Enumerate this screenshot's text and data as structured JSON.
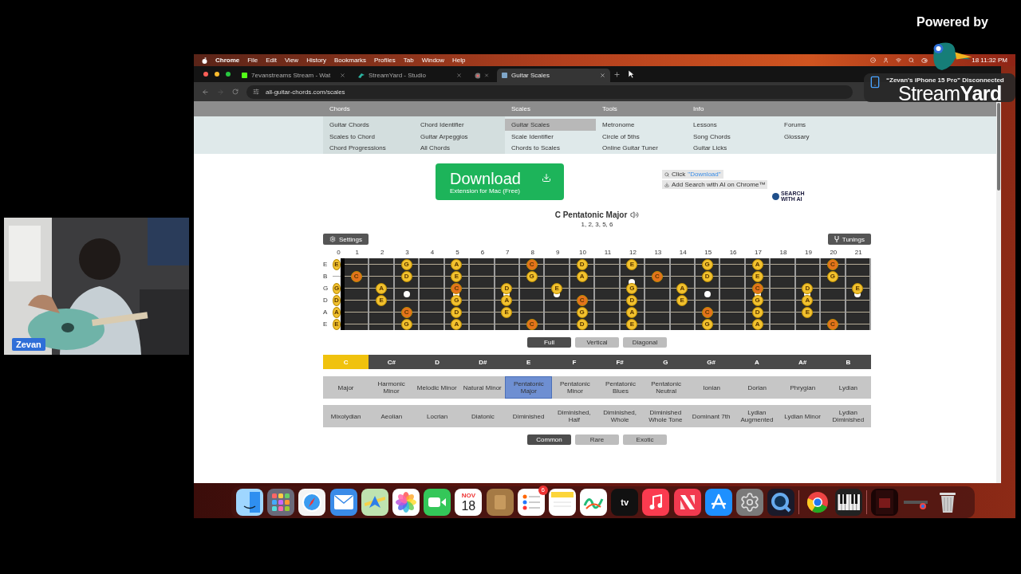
{
  "stream": {
    "powered_by": "Powered by",
    "logo": "Stream**Yard**",
    "participant": "Zevan"
  },
  "menu_bar": {
    "app": "Chrome",
    "items": [
      "File",
      "Edit",
      "View",
      "History",
      "Bookmarks",
      "Profiles",
      "Tab",
      "Window",
      "Help"
    ],
    "clock": "18 11:32 PM"
  },
  "notification": {
    "title": "“Zevan's iPhone 15 Pro” Disconnected"
  },
  "browser": {
    "tabs": [
      {
        "kind": "k",
        "title": "7evanstreams Stream - Wat",
        "selected": false
      },
      {
        "kind": "bird",
        "title": "StreamYard - Studio",
        "selected": false
      },
      {
        "kind": "record",
        "selected": false
      },
      {
        "kind": "page",
        "title": "Guitar Scales",
        "selected": true
      }
    ],
    "url": "all-guitar-chords.com/scales"
  },
  "nav": {
    "groups": [
      {
        "heading": "Chords",
        "columns": [
          {
            "items": [
              {
                "label": "Guitar Chords",
                "selected": false
              },
              {
                "label": "Scales to Chord",
                "selected": false
              },
              {
                "label": "Chord Progressions",
                "selected": false
              }
            ]
          },
          {
            "items": [
              {
                "label": "Chord Identifier",
                "selected": false
              },
              {
                "label": "Guitar Arpeggios",
                "selected": false
              },
              {
                "label": "All Chords",
                "selected": false
              }
            ]
          }
        ]
      },
      {
        "heading": "Scales",
        "columns": [
          {
            "items": [
              {
                "label": "Guitar Scales",
                "selected": true
              },
              {
                "label": "Scale Identifier",
                "selected": false
              },
              {
                "label": "Chords to Scales",
                "selected": false
              }
            ]
          }
        ]
      },
      {
        "heading": "Tools",
        "columns": [
          {
            "items": [
              {
                "label": "Metronome",
                "selected": false
              },
              {
                "label": "Circle of 5ths",
                "selected": false
              },
              {
                "label": "Online Guitar Tuner",
                "selected": false
              }
            ]
          }
        ]
      },
      {
        "heading": "Info",
        "columns": [
          {
            "items": [
              {
                "label": "Lessons",
                "selected": false
              },
              {
                "label": "Song Chords",
                "selected": false
              },
              {
                "label": "Guitar Licks",
                "selected": false
              }
            ]
          },
          {
            "items": [
              {
                "label": "Forums",
                "selected": false
              },
              {
                "label": "Glossary",
                "selected": false
              }
            ]
          }
        ]
      }
    ]
  },
  "ad": {
    "button": "Download",
    "button_sub": "Extension for Mac (Free)",
    "click": "Click",
    "click_link": "\"Download\"",
    "add": "Add Search with AI on Chrome™",
    "badge": "SEARCH WITH AI"
  },
  "scale": {
    "title": "C Pentatonic Major",
    "formula": "1, 2, 3, 5, 6"
  },
  "settings_button": "Settings",
  "tunings_button": "Tunings",
  "fretboard": {
    "frets": [
      "0",
      "1",
      "2",
      "3",
      "4",
      "5",
      "6",
      "7",
      "8",
      "9",
      "10",
      "11",
      "12",
      "13",
      "14",
      "15",
      "16",
      "17",
      "18",
      "19",
      "20",
      "21"
    ],
    "strings": [
      {
        "label": "E",
        "cells": [
          {
            "note": "E",
            "color": "#f2c12e"
          },
          null,
          null,
          {
            "note": "G",
            "color": "#f2c12e"
          },
          null,
          {
            "note": "A",
            "color": "#f2c12e"
          },
          null,
          null,
          {
            "note": "C",
            "color": "#e4731c"
          },
          null,
          {
            "note": "D",
            "color": "#f2c12e"
          },
          null,
          {
            "note": "E",
            "color": "#f2c12e"
          },
          null,
          null,
          {
            "note": "G",
            "color": "#f2c12e"
          },
          null,
          {
            "note": "A",
            "color": "#f2c12e"
          },
          null,
          null,
          {
            "note": "C",
            "color": "#e4731c"
          },
          null
        ]
      },
      {
        "label": "B",
        "cells": [
          null,
          {
            "note": "C",
            "color": "#e4731c"
          },
          null,
          {
            "note": "D",
            "color": "#f2c12e"
          },
          null,
          {
            "note": "E",
            "color": "#f2c12e"
          },
          null,
          null,
          {
            "note": "G",
            "color": "#f2c12e"
          },
          null,
          {
            "note": "A",
            "color": "#f2c12e"
          },
          null,
          null,
          {
            "note": "C",
            "color": "#e4731c"
          },
          null,
          {
            "note": "D",
            "color": "#f2c12e"
          },
          null,
          {
            "note": "E",
            "color": "#f2c12e"
          },
          null,
          null,
          {
            "note": "G",
            "color": "#f2c12e"
          },
          null
        ]
      },
      {
        "label": "G",
        "cells": [
          {
            "note": "G",
            "color": "#f2c12e"
          },
          null,
          {
            "note": "A",
            "color": "#f2c12e"
          },
          null,
          null,
          {
            "note": "C",
            "color": "#e4731c"
          },
          null,
          {
            "note": "D",
            "color": "#f2c12e"
          },
          null,
          {
            "note": "E",
            "color": "#f2c12e"
          },
          null,
          null,
          {
            "note": "G",
            "color": "#f2c12e"
          },
          null,
          {
            "note": "A",
            "color": "#f2c12e"
          },
          null,
          null,
          {
            "note": "C",
            "color": "#e4731c"
          },
          null,
          {
            "note": "D",
            "color": "#f2c12e"
          },
          null,
          {
            "note": "E",
            "color": "#f2c12e"
          }
        ]
      },
      {
        "label": "D",
        "cells": [
          {
            "note": "D",
            "color": "#f2c12e"
          },
          null,
          {
            "note": "E",
            "color": "#f2c12e"
          },
          null,
          null,
          {
            "note": "G",
            "color": "#f2c12e"
          },
          null,
          {
            "note": "A",
            "color": "#f2c12e"
          },
          null,
          null,
          {
            "note": "C",
            "color": "#e4731c"
          },
          null,
          {
            "note": "D",
            "color": "#f2c12e"
          },
          null,
          {
            "note": "E",
            "color": "#f2c12e"
          },
          null,
          null,
          {
            "note": "G",
            "color": "#f2c12e"
          },
          null,
          {
            "note": "A",
            "color": "#f2c12e"
          },
          null,
          null
        ]
      },
      {
        "label": "A",
        "cells": [
          {
            "note": "A",
            "color": "#f2c12e"
          },
          null,
          null,
          {
            "note": "C",
            "color": "#e4731c"
          },
          null,
          {
            "note": "D",
            "color": "#f2c12e"
          },
          null,
          {
            "note": "E",
            "color": "#f2c12e"
          },
          null,
          null,
          {
            "note": "G",
            "color": "#f2c12e"
          },
          null,
          {
            "note": "A",
            "color": "#f2c12e"
          },
          null,
          null,
          {
            "note": "C",
            "color": "#e4731c"
          },
          null,
          {
            "note": "D",
            "color": "#f2c12e"
          },
          null,
          {
            "note": "E",
            "color": "#f2c12e"
          },
          null,
          null
        ]
      },
      {
        "label": "E",
        "cells": [
          {
            "note": "E",
            "color": "#f2c12e"
          },
          null,
          null,
          {
            "note": "G",
            "color": "#f2c12e"
          },
          null,
          {
            "note": "A",
            "color": "#f2c12e"
          },
          null,
          null,
          {
            "note": "C",
            "color": "#e4731c"
          },
          null,
          {
            "note": "D",
            "color": "#f2c12e"
          },
          null,
          {
            "note": "E",
            "color": "#f2c12e"
          },
          null,
          null,
          {
            "note": "G",
            "color": "#f2c12e"
          },
          null,
          {
            "note": "A",
            "color": "#f2c12e"
          },
          null,
          null,
          {
            "note": "C",
            "color": "#e4731c"
          },
          null
        ]
      }
    ]
  },
  "views": [
    {
      "label": "Full",
      "selected": true
    },
    {
      "label": "Vertical",
      "selected": false
    },
    {
      "label": "Diagonal",
      "selected": false
    }
  ],
  "keys": [
    {
      "label": "C",
      "selected": true
    },
    {
      "label": "C#",
      "selected": false
    },
    {
      "label": "D",
      "selected": false
    },
    {
      "label": "D#",
      "selected": false
    },
    {
      "label": "E",
      "selected": false
    },
    {
      "label": "F",
      "selected": false
    },
    {
      "label": "F#",
      "selected": false
    },
    {
      "label": "G",
      "selected": false
    },
    {
      "label": "G#",
      "selected": false
    },
    {
      "label": "A",
      "selected": false
    },
    {
      "label": "A#",
      "selected": false
    },
    {
      "label": "B",
      "selected": false
    }
  ],
  "scale_rows": [
    {
      "items": [
        {
          "label": "Major",
          "selected": false
        },
        {
          "label": "Harmonic Minor",
          "selected": false
        },
        {
          "label": "Melodic Minor",
          "selected": false
        },
        {
          "label": "Natural Minor",
          "selected": false
        },
        {
          "label": "Pentatonic Major",
          "selected": true
        },
        {
          "label": "Pentatonic Minor",
          "selected": false
        },
        {
          "label": "Pentatonic Blues",
          "selected": false
        },
        {
          "label": "Pentatonic Neutral",
          "selected": false
        },
        {
          "label": "Ionian",
          "selected": false
        },
        {
          "label": "Dorian",
          "selected": false
        },
        {
          "label": "Phrygian",
          "selected": false
        },
        {
          "label": "Lydian",
          "selected": false
        }
      ]
    },
    {
      "items": [
        {
          "label": "Mixolydian",
          "selected": false
        },
        {
          "label": "Aeolian",
          "selected": false
        },
        {
          "label": "Locrian",
          "selected": false
        },
        {
          "label": "Diatonic",
          "selected": false
        },
        {
          "label": "Diminished",
          "selected": false
        },
        {
          "label": "Diminished, Half",
          "selected": false
        },
        {
          "label": "Diminished, Whole",
          "selected": false
        },
        {
          "label": "Diminished Whole Tone",
          "selected": false
        },
        {
          "label": "Dominant 7th",
          "selected": false
        },
        {
          "label": "Lydian Augmented",
          "selected": false
        },
        {
          "label": "Lydian Minor",
          "selected": false
        },
        {
          "label": "Lydian Diminished",
          "selected": false
        }
      ]
    }
  ],
  "categories": [
    {
      "label": "Common",
      "selected": true
    },
    {
      "label": "Rare",
      "selected": false
    },
    {
      "label": "Exotic",
      "selected": false
    }
  ],
  "dock": [
    {
      "kind": "finder"
    },
    {
      "kind": "launchpad"
    },
    {
      "kind": "safari"
    },
    {
      "kind": "mail"
    },
    {
      "kind": "maps"
    },
    {
      "kind": "photos"
    },
    {
      "kind": "facetime"
    },
    {
      "kind": "calendar",
      "month": "NOV",
      "day": "18"
    },
    {
      "kind": "contacts"
    },
    {
      "kind": "reminders",
      "badge": "6"
    },
    {
      "kind": "notes"
    },
    {
      "kind": "freeform"
    },
    {
      "kind": "tv",
      "label": "tv"
    },
    {
      "kind": "music"
    },
    {
      "kind": "news"
    },
    {
      "kind": "appstore"
    },
    {
      "kind": "settings"
    },
    {
      "kind": "quicktime"
    },
    {
      "kind": "separator"
    },
    {
      "kind": "chrome"
    },
    {
      "kind": "piano"
    },
    {
      "kind": "separator"
    },
    {
      "kind": "document"
    },
    {
      "kind": "window"
    },
    {
      "kind": "trash"
    }
  ]
}
